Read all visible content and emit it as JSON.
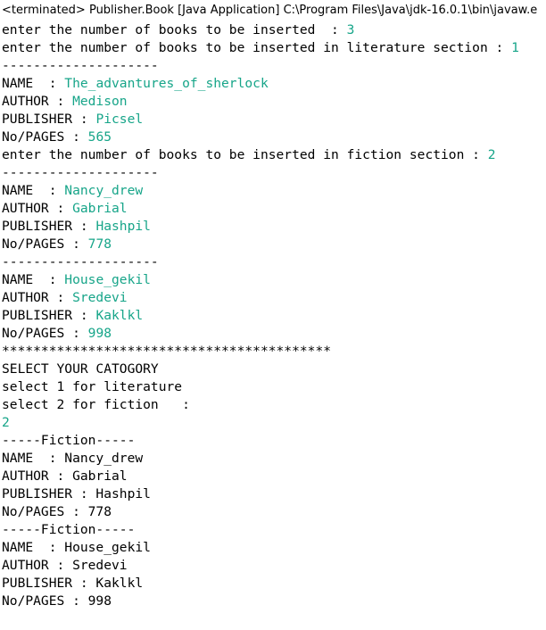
{
  "console": {
    "header": "<terminated> Publisher.Book [Java Application] C:\\Program Files\\Java\\jdk-16.0.1\\bin\\javaw.e",
    "input_color": "#17a589",
    "lines": [
      {
        "text": "enter the number of books to be inserted  : ",
        "input": "3"
      },
      {
        "text": "enter the number of books to be inserted in literature section : ",
        "input": "1"
      },
      {
        "text": "--------------------",
        "input": ""
      },
      {
        "text": "NAME  : ",
        "input": "The_advantures_of_sherlock"
      },
      {
        "text": "AUTHOR : ",
        "input": "Medison"
      },
      {
        "text": "PUBLISHER : ",
        "input": "Picsel"
      },
      {
        "text": "No/PAGES : ",
        "input": "565"
      },
      {
        "text": "enter the number of books to be inserted in fiction section : ",
        "input": "2"
      },
      {
        "text": "--------------------",
        "input": ""
      },
      {
        "text": "NAME  : ",
        "input": "Nancy_drew"
      },
      {
        "text": "AUTHOR : ",
        "input": "Gabrial"
      },
      {
        "text": "PUBLISHER : ",
        "input": "Hashpil"
      },
      {
        "text": "No/PAGES : ",
        "input": "778"
      },
      {
        "text": "--------------------",
        "input": ""
      },
      {
        "text": "NAME  : ",
        "input": "House_gekil"
      },
      {
        "text": "AUTHOR : ",
        "input": "Sredevi"
      },
      {
        "text": "PUBLISHER : ",
        "input": "Kaklkl"
      },
      {
        "text": "No/PAGES : ",
        "input": "998"
      },
      {
        "text": "******************************************",
        "input": ""
      },
      {
        "text": "SELECT YOUR CATOGORY",
        "input": ""
      },
      {
        "text": "select 1 for literature",
        "input": ""
      },
      {
        "text": "select 2 for fiction   :",
        "input": ""
      },
      {
        "text": "",
        "input": "2"
      },
      {
        "text": "-----Fiction-----",
        "input": ""
      },
      {
        "text": "NAME  : Nancy_drew",
        "input": ""
      },
      {
        "text": "AUTHOR : Gabrial",
        "input": ""
      },
      {
        "text": "PUBLISHER : Hashpil",
        "input": ""
      },
      {
        "text": "No/PAGES : 778",
        "input": ""
      },
      {
        "text": "-----Fiction-----",
        "input": ""
      },
      {
        "text": "NAME  : House_gekil",
        "input": ""
      },
      {
        "text": "AUTHOR : Sredevi",
        "input": ""
      },
      {
        "text": "PUBLISHER : Kaklkl",
        "input": ""
      },
      {
        "text": "No/PAGES : 998",
        "input": ""
      }
    ]
  }
}
